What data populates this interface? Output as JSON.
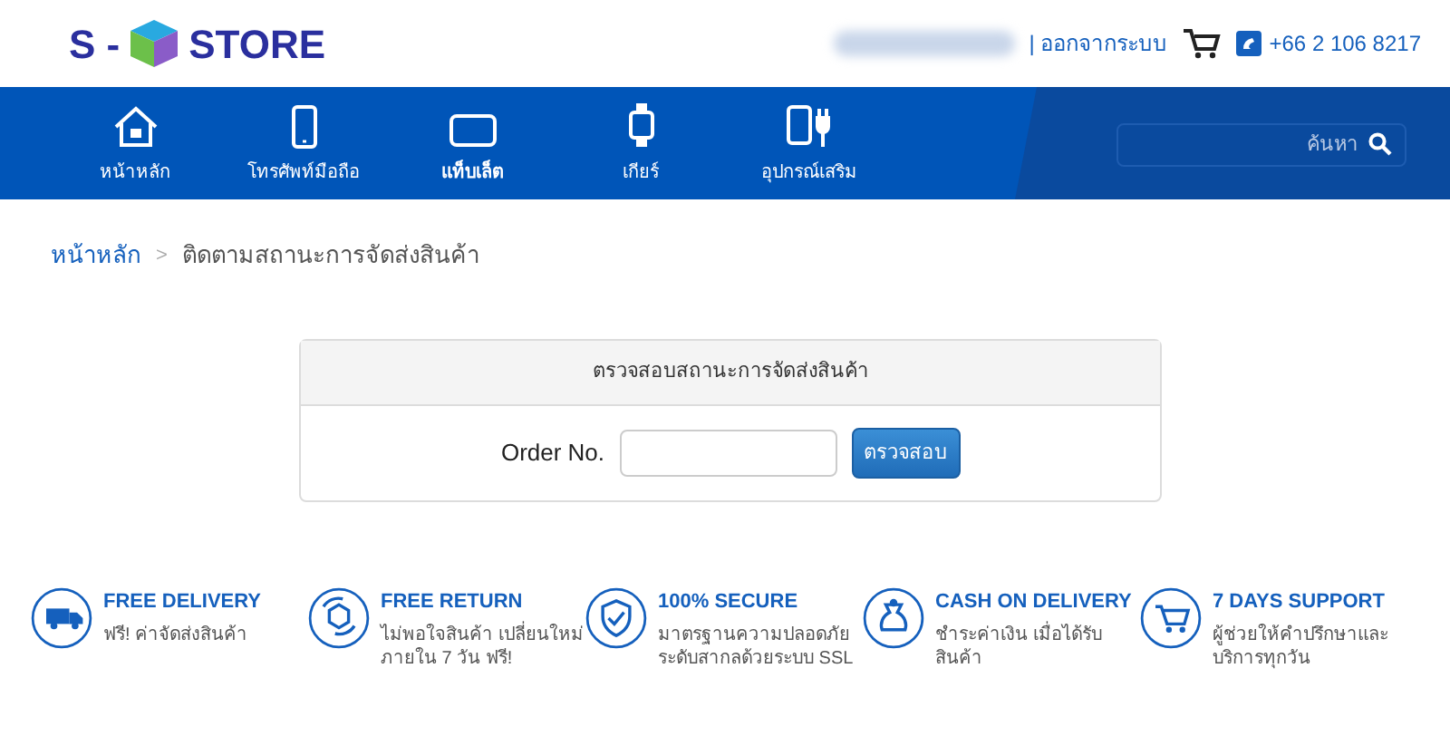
{
  "logo": {
    "left": "S -",
    "right": "STORE"
  },
  "header": {
    "logout": "| ออกจากระบบ",
    "phone": "+66 2 106 8217"
  },
  "nav": [
    {
      "label": "หน้าหลัก",
      "selected": false
    },
    {
      "label": "โทรศัพท์มือถือ",
      "selected": false
    },
    {
      "label": "แท็บเล็ต",
      "selected": true
    },
    {
      "label": "เกียร์",
      "selected": false
    },
    {
      "label": "อุปกรณ์เสริม",
      "selected": false
    }
  ],
  "search": {
    "placeholder": "ค้นหา"
  },
  "breadcrumb": [
    {
      "label": "หน้าหลัก",
      "kind": "link"
    },
    {
      "label": ">",
      "kind": "separator"
    },
    {
      "label": "ติดตามสถานะการจัดส่งสินค้า",
      "kind": "current"
    }
  ],
  "panel": {
    "title": "ตรวจสอบสถานะการจัดส่งสินค้า",
    "field_label": "Order No.",
    "button": "ตรวจสอบ"
  },
  "features": [
    {
      "title": "FREE DELIVERY",
      "text": "ฟรี! ค่าจัดส่งสินค้า"
    },
    {
      "title": "FREE RETURN",
      "text": "ไม่พอใจสินค้า เปลี่ยนใหม่ภายใน 7 วัน ฟรี!"
    },
    {
      "title": "100% SECURE",
      "text": "มาตรฐานความปลอดภัยระดับสากลด้วยระบบ SSL"
    },
    {
      "title": "CASH ON DELIVERY",
      "text": "ชำระค่าเงิน เมื่อได้รับสินค้า"
    },
    {
      "title": "7 DAYS SUPPORT",
      "text": "ผู้ช่วยให้คำปรึกษาและบริการทุกวัน"
    }
  ]
}
